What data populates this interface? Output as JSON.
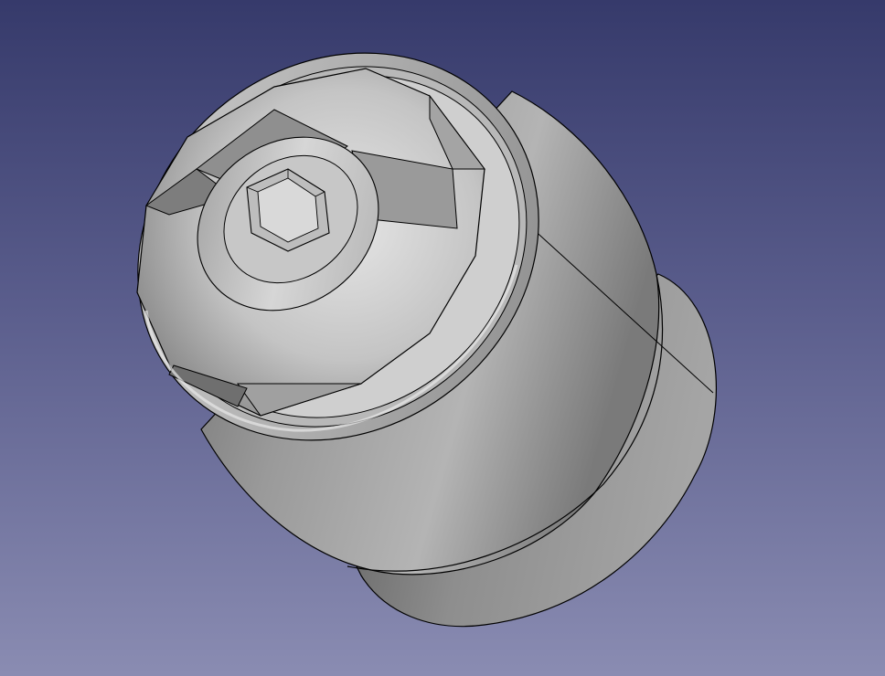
{
  "viewport": {
    "background_top": "#363a6b",
    "background_bottom": "#8a8cb2"
  },
  "model": {
    "kind": "3d-cad-part",
    "shape": "cylindrical socket with twelve-point internal socket and hex drive",
    "base_color": "#a9a9a9",
    "edge_color": "#000000"
  }
}
